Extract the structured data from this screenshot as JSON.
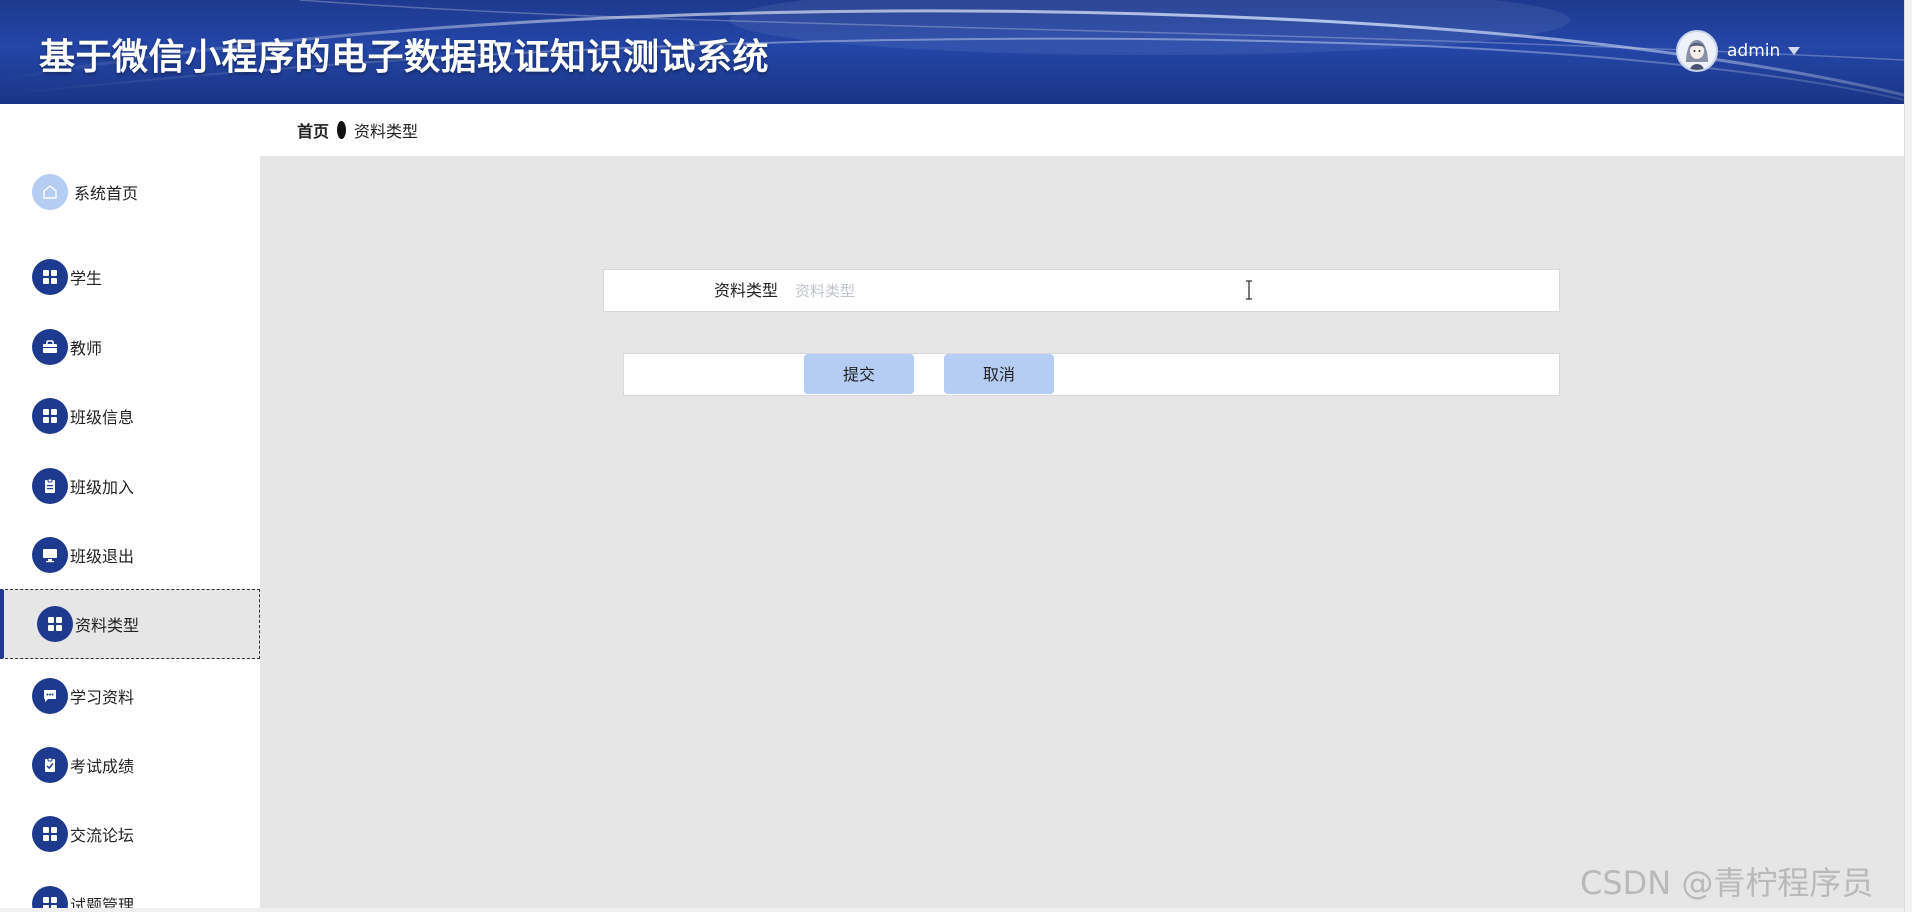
{
  "header": {
    "title": "基于微信小程序的电子数据取证知识测试系统",
    "username": "admin",
    "avatar_icon": "avatar-anime-girl",
    "caret_icon": "caret-down-icon",
    "background_color": "#1e3a8f"
  },
  "breadcrumb": {
    "home": "首页",
    "current": "资料类型"
  },
  "sidebar": {
    "items": [
      {
        "label": "系统首页",
        "icon": "home-icon"
      },
      {
        "label": "学生",
        "icon": "grid-icon"
      },
      {
        "label": "教师",
        "icon": "briefcase-icon"
      },
      {
        "label": "班级信息",
        "icon": "grid-icon"
      },
      {
        "label": "班级加入",
        "icon": "clipboard-icon"
      },
      {
        "label": "班级退出",
        "icon": "monitor-icon"
      },
      {
        "label": "资料类型",
        "icon": "grid-icon",
        "active": true
      },
      {
        "label": "学习资料",
        "icon": "chat-icon"
      },
      {
        "label": "考试成绩",
        "icon": "clipboard-check-icon"
      },
      {
        "label": "交流论坛",
        "icon": "grid-icon"
      },
      {
        "label": "试题管理",
        "icon": "grid-icon"
      }
    ]
  },
  "form": {
    "field_label": "资料类型",
    "field_placeholder": "资料类型",
    "field_value": "",
    "submit_label": "提交",
    "cancel_label": "取消"
  },
  "watermark": "CSDN @青柠程序员",
  "colors": {
    "accent": "#1e3a8f",
    "button": "#b5ccf3",
    "content_bg": "#e6e6e6"
  }
}
